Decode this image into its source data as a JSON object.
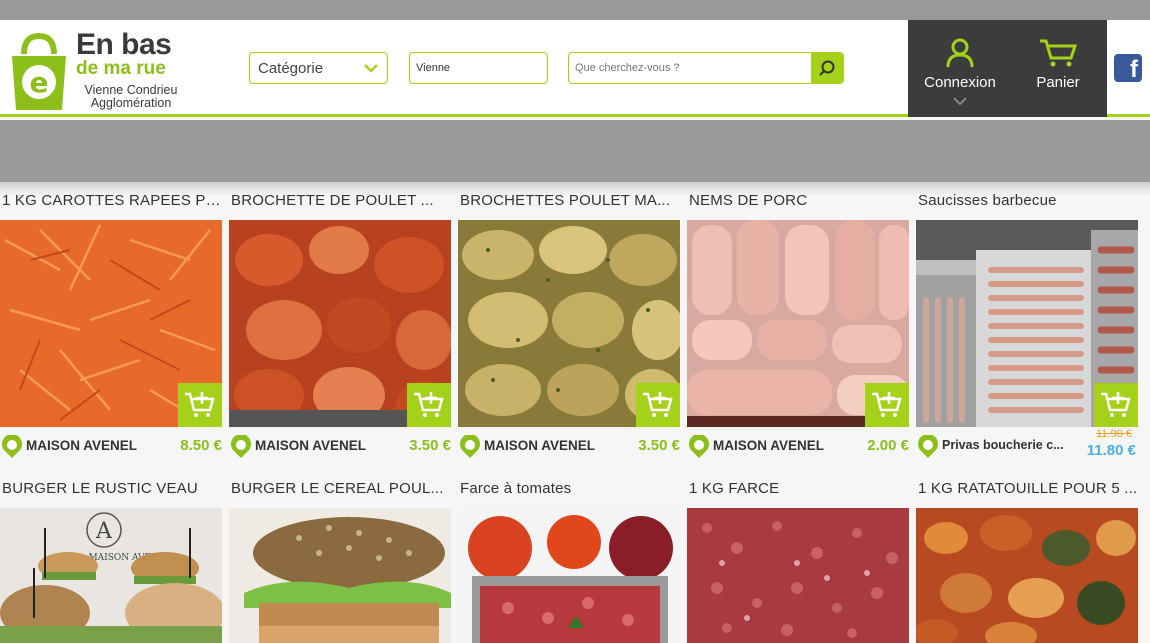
{
  "brand": {
    "line1": "En bas",
    "line2": "de ma rue",
    "line3": "Vienne Condrieu",
    "line4": "Agglomération",
    "accent": "#a6d11b",
    "dark": "#3c3c3c"
  },
  "filters": {
    "category_label": "Catégorie",
    "city_value": "Vienne",
    "search_placeholder": "Que cherchez-vous ?"
  },
  "account": {
    "login_label": "Connexion",
    "cart_label": "Panier"
  },
  "products_row1": [
    {
      "title": "1 KG CAROTTES RAPEES PO...",
      "vendor": "MAISON AVENEL",
      "price": "8.50 €",
      "image": "grated-carrots"
    },
    {
      "title": "BROCHETTE DE POULET ...",
      "vendor": "MAISON AVENEL",
      "price": "3.50 €",
      "image": "chicken-skewers-red"
    },
    {
      "title": "BROCHETTES POULET MA...",
      "vendor": "MAISON AVENEL",
      "price": "3.50 €",
      "image": "chicken-skewers-herbs"
    },
    {
      "title": "NEMS DE PORC",
      "vendor": "MAISON AVENEL",
      "price": "2.00 €",
      "image": "pork-spring-rolls"
    },
    {
      "title": "Saucisses barbecue",
      "vendor": "Privas boucherie c...",
      "old_price": "11.90 €",
      "price": "11.80 €",
      "image": "bbq-sausages"
    }
  ],
  "products_row2": [
    {
      "title": "BURGER LE RUSTIC VEAU",
      "image": "burgers"
    },
    {
      "title": "BURGER LE CEREAL POUL...",
      "image": "cereal-burger"
    },
    {
      "title": "Farce à tomates",
      "image": "stuffed-tomatoes"
    },
    {
      "title": "1 KG FARCE",
      "image": "minced-meat"
    },
    {
      "title": "1 KG RATATOUILLE POUR 5 ...",
      "image": "ratatouille"
    }
  ],
  "photo_text": {
    "burger_logo_letter": "A",
    "burger_logo_text": "MAISON AVENEL"
  }
}
